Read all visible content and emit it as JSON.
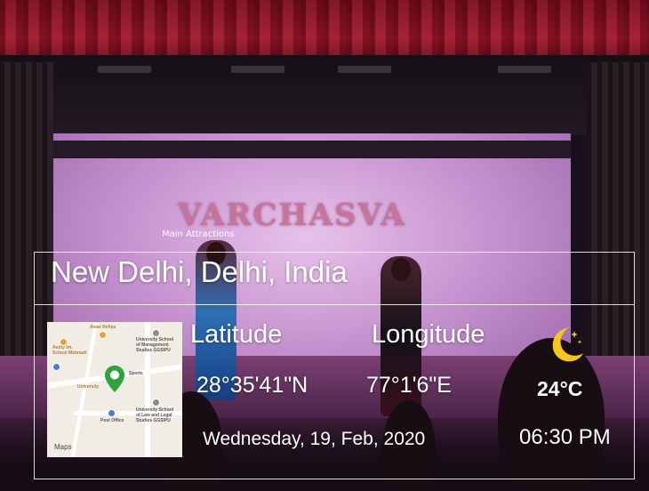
{
  "overlay": {
    "location": "New Delhi, Delhi, India",
    "latitude_label": "Latitude",
    "longitude_label": "Longitude",
    "latitude_value": "28°35'41\"N",
    "longitude_value": "77°1'6\"E",
    "temperature": "24°C",
    "date": "Wednesday, 19, Feb, 2020",
    "time": "06:30 PM",
    "weather_icon": "moon-stars-icon"
  },
  "map": {
    "labels": [
      "Amity Int. School Mehrauli",
      "Amar Rehya",
      "University School of Management Studies GGSIPU",
      "University School of Law and Legal Studies GGSIPU",
      "Post Office",
      "University",
      "Sports"
    ],
    "attribution": "Maps",
    "pin_color": "#2fa33e"
  },
  "backdrop": {
    "banner_title": "VARCHASVA",
    "banner_subtitle": "Main Attractions"
  },
  "colors": {
    "overlay_text": "#ffffff",
    "moon": "#f7c51e"
  }
}
